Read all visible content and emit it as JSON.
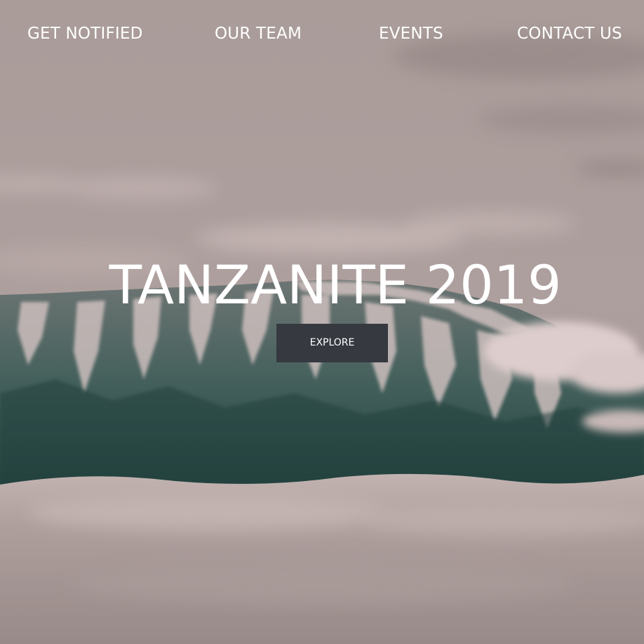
{
  "nav": {
    "items": [
      {
        "label": "GET NOTIFIED"
      },
      {
        "label": "OUR TEAM"
      },
      {
        "label": "EVENTS"
      },
      {
        "label": "CONTACT US"
      }
    ]
  },
  "hero": {
    "title": "TANZANITE 2019",
    "cta_label": "EXPLORE"
  },
  "colors": {
    "sky": "#a89a97",
    "mountain_dark": "#2e4a47",
    "snow": "#d6c6c6",
    "button_bg": "#363940",
    "text": "#ffffff"
  }
}
